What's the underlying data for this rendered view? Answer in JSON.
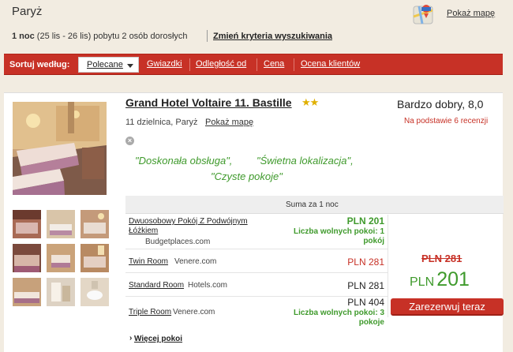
{
  "header": {
    "city": "Paryż",
    "stay_nights": "1 noc",
    "stay_rest": " (25 lis - 26 lis) pobytu 2 osób dorosłych",
    "change_criteria": "Zmień kryteria wyszukiwania",
    "show_map": "Pokaż mapę",
    "map_icon": "map-pin-icon"
  },
  "sortbar": {
    "label": "Sortuj według:",
    "selected": "Polecane",
    "options": [
      "Gwiazdki",
      "Odległość od",
      "Cena",
      "Ocena klientów"
    ]
  },
  "hotel": {
    "name": "Grand Hotel Voltaire 11. Bastille",
    "stars": 2,
    "stars_glyph": "★★",
    "district": "11 dzielnica, Paryż",
    "show_map": "Pokaż mapę",
    "quote1": "\"Doskonała obsługa\",",
    "quote2": "\"Świetna lokalizacja\",",
    "quote3": "\"Czyste pokoje\"",
    "rating": "Bardzo dobry, 8,0",
    "reviews_prefix": "Na podstawie ",
    "reviews_count": "6",
    "reviews_suffix": " recenzji"
  },
  "table": {
    "header": "Suma za 1 noc",
    "rows": [
      {
        "room": "Dwuosobowy Pokój Z Podwójnym Łóżkiem",
        "provider": "Budgetplaces.com",
        "price": "PLN 201",
        "availability": "Liczba wolnych pokoi: 1 pokój"
      },
      {
        "room": "Twin Room",
        "provider": "Venere.com",
        "price": "PLN 281",
        "availability": ""
      },
      {
        "room": "Standard Room",
        "provider": "Hotels.com",
        "price": "PLN 281",
        "availability": ""
      },
      {
        "room": "Triple Room",
        "provider": "Venere.com",
        "price": "PLN 404",
        "availability": "Liczba wolnych pokoi: 3 pokoje"
      }
    ],
    "old_price": "PLN 281",
    "best_currency": "PLN",
    "best_amount": "201",
    "book_button": "Zarezerwuj teraz",
    "more_rooms": "Więcej pokoi",
    "more_glyph": "›"
  },
  "colors": {
    "accent_red": "#c73126",
    "green": "#3f9a2c",
    "background": "#f2ece1"
  }
}
